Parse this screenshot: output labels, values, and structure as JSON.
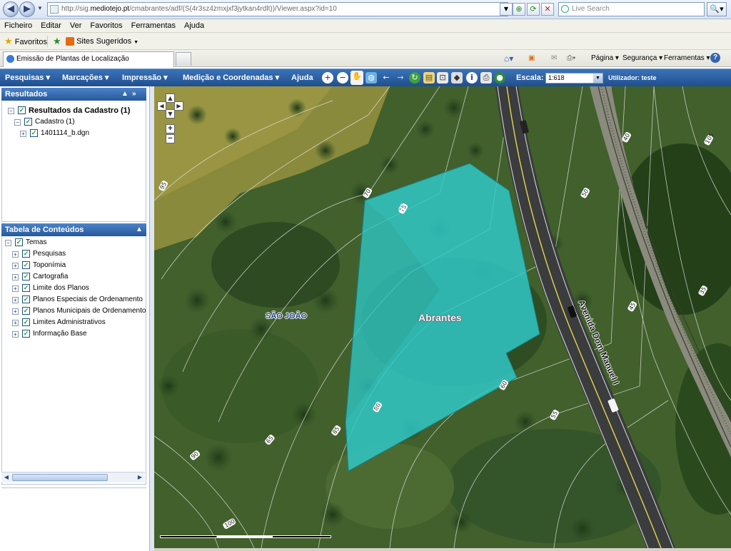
{
  "browser": {
    "url_prefix": "http://sig.",
    "url_host": "mediotejo.pt",
    "url_rest": "/cmabrantes/adf/(S(4r3sz4zmxjxf3jytkan4rdlt))/Viewer.aspx?id=10",
    "search_placeholder": "Live Search",
    "menu": [
      "Ficheiro",
      "Editar",
      "Ver",
      "Favoritos",
      "Ferramentas",
      "Ajuda"
    ],
    "favorites_label": "Favoritos",
    "suggested_sites_label": "Sites Sugeridos",
    "tab_title": "Emissão de Plantas de Localização",
    "commands": {
      "page": "Página",
      "security": "Segurança",
      "tools": "Ferramentas"
    }
  },
  "app_toolbar": {
    "menus": {
      "search": "Pesquisas",
      "markups": "Marcações",
      "print": "Impressão",
      "measure": "Medição e Coordenadas",
      "help": "Ajuda"
    },
    "scale_label": "Escala:",
    "scale_value": "1:618",
    "user_label": "Utilizador: teste"
  },
  "results_panel": {
    "title": "Resultados",
    "items": [
      {
        "label": "Resultados da Cadastro (1)",
        "bold": true
      },
      {
        "label": "Cadastro (1)"
      },
      {
        "label": "1401114_b.dgn"
      }
    ]
  },
  "toc_panel": {
    "title": "Tabela de Conteúdos",
    "root": "Temas",
    "themes": [
      "Pesquisas",
      "Toponímia",
      "Cartografia",
      "Limite dos Planos",
      "Planos Especiais de Ordenamento",
      "Planos Municipais de Ordenamento",
      "Limites Administrativos",
      "Informação Base"
    ]
  },
  "map": {
    "place_label": "SÃO JOÃO",
    "parcel_label": "Abrantes",
    "road_label": "Avenida Dom Manuel I",
    "parcel_color": "#2ec6c6",
    "contour_labels": [
      "95",
      "70",
      "75",
      "80",
      "85",
      "65",
      "90",
      "100",
      "60",
      "55",
      "50",
      "45",
      "40",
      "35",
      "105"
    ]
  },
  "colors": {
    "toolbar_bg": "#2a5ea3",
    "panel_header": "#3a71b5",
    "parcel_fill": "#2ec6c6"
  }
}
